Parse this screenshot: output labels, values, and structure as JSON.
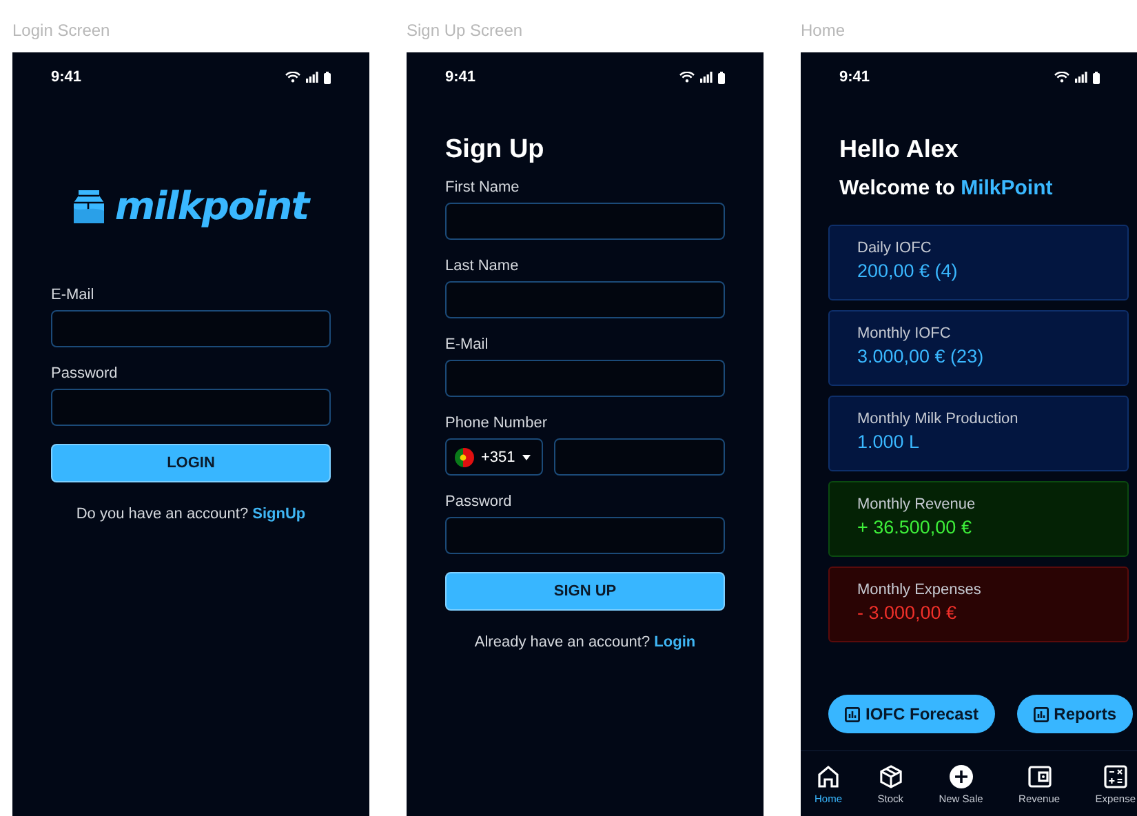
{
  "login": {
    "caption": "Login Screen",
    "time": "9:41",
    "logo": "milkpoint",
    "fields": [
      {
        "label": "E-Mail"
      },
      {
        "label": "Password"
      }
    ],
    "button": "LOGIN",
    "prompt": "Do you have an account?",
    "link": "SignUp"
  },
  "signup": {
    "caption": "Sign Up Screen",
    "time": "9:41",
    "title": "Sign Up",
    "fields": [
      {
        "label": "First Name",
        "kind": "text"
      },
      {
        "label": "Last Name",
        "kind": "text"
      },
      {
        "label": "E-Mail",
        "kind": "text"
      },
      {
        "label": "Phone Number",
        "kind": "phone",
        "code": "+351"
      },
      {
        "label": "Password",
        "kind": "text"
      }
    ],
    "button": "SIGN UP",
    "prompt": "Already have an account?",
    "link": "Login"
  },
  "home": {
    "caption": "Home",
    "time": "9:41",
    "greeting": "Hello Alex",
    "welcome": "Welcome to",
    "brand": "MilkPoint",
    "cards": [
      {
        "label": "Daily IOFC",
        "value": "200,00 € (4)",
        "kind": "info"
      },
      {
        "label": "Monthly IOFC",
        "value": "3.000,00 € (23)",
        "kind": "info"
      },
      {
        "label": "Monthly Milk Production",
        "value": "1.000 L",
        "kind": "info"
      },
      {
        "label": "Monthly Revenue",
        "value": "+ 36.500,00 €",
        "kind": "positive"
      },
      {
        "label": "Monthly Expenses",
        "value": "- 3.000,00 €",
        "kind": "negative"
      }
    ],
    "actions": [
      "IOFC Forecast",
      "Reports"
    ],
    "nav": [
      {
        "label": "Home",
        "kind": "home",
        "selected": true
      },
      {
        "label": "Stock",
        "kind": "box",
        "selected": false
      },
      {
        "label": "New Sale",
        "kind": "plus",
        "selected": false
      },
      {
        "label": "Revenue",
        "kind": "wallet",
        "selected": false
      },
      {
        "label": "Expense",
        "kind": "calc",
        "selected": false
      }
    ]
  }
}
